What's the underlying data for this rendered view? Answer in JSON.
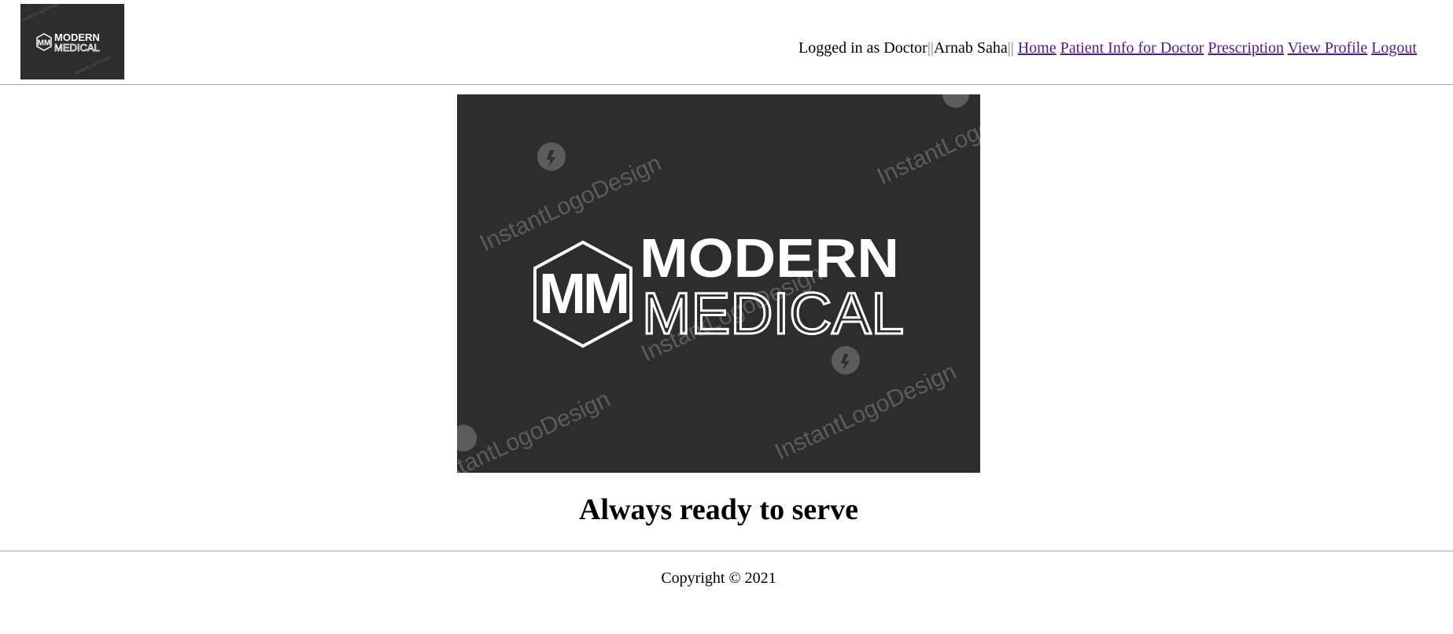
{
  "header": {
    "logo_alt": "Modern Medical logo",
    "user_status": "Logged in as Doctor",
    "separator_left": "||",
    "user_name": "Arnab Saha",
    "separator_right": "||",
    "nav": {
      "home": "Home",
      "patient_info": "Patient Info for Doctor",
      "prescription": "Prescription",
      "view_profile": "View Profile",
      "logout": "Logout"
    }
  },
  "hero": {
    "brand_line1": "MODERN",
    "brand_line2": "MEDICAL",
    "monogram": "MM",
    "watermark": "InstantLogoDesign"
  },
  "tagline": "Always ready to serve",
  "footer": {
    "copyright": "Copyright © 2021"
  },
  "colors": {
    "logo_background": "#2d2d2d",
    "visited_link": "#551a8b"
  }
}
